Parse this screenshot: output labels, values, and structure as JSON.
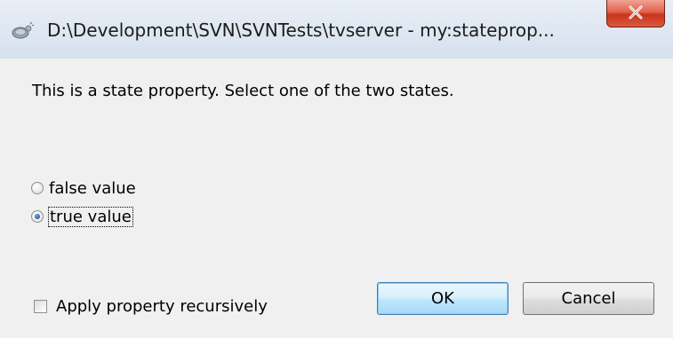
{
  "window": {
    "title": "D:\\Development\\SVN\\SVNTests\\tvserver - my:stateprop...",
    "app_icon": "tortoisesvn-icon",
    "close_icon": "close-icon",
    "close_color": "#c7341c"
  },
  "dialog": {
    "prompt": "This is a state property. Select one of the two states.",
    "options": [
      {
        "label": "false value",
        "selected": false
      },
      {
        "label": "true value",
        "selected": true
      }
    ],
    "recursive_checkbox": {
      "label": "Apply property recursively",
      "checked": false
    },
    "ok_label": "OK",
    "cancel_label": "Cancel"
  }
}
